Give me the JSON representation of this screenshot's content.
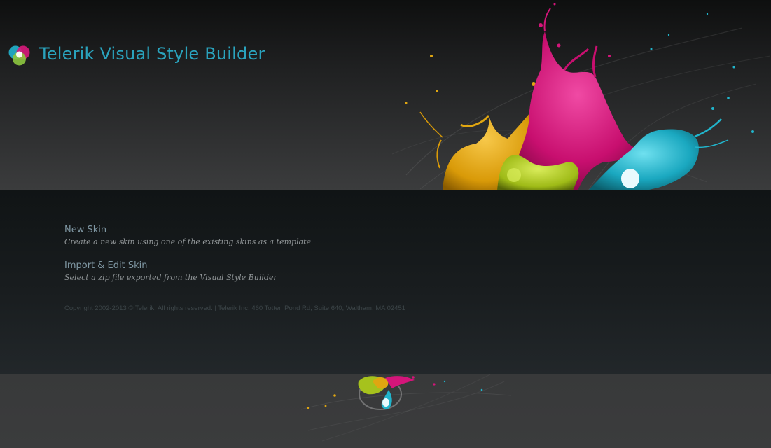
{
  "header": {
    "title": "Telerik Visual Style Builder",
    "logo_icon": "telerik-logo-icon"
  },
  "actions": [
    {
      "title": "New Skin",
      "description": "Create a new skin using one of the existing skins as a template"
    },
    {
      "title": "Import & Edit Skin",
      "description": "Select a zip file exported from the Visual Style Builder"
    }
  ],
  "footer": {
    "copyright": "Copyright 2002-2013 © Telerik. All rights reserved. | Telerik Inc, 460 Totten Pond Rd, Suite 640, Waltham, MA 02451"
  },
  "colors": {
    "accent": "#2aa3bd",
    "link": "#7f97a3",
    "paint_yellow": "#e0a611",
    "paint_magenta": "#d4157a",
    "paint_cyan": "#21b5cc",
    "paint_green": "#a6c21d"
  }
}
